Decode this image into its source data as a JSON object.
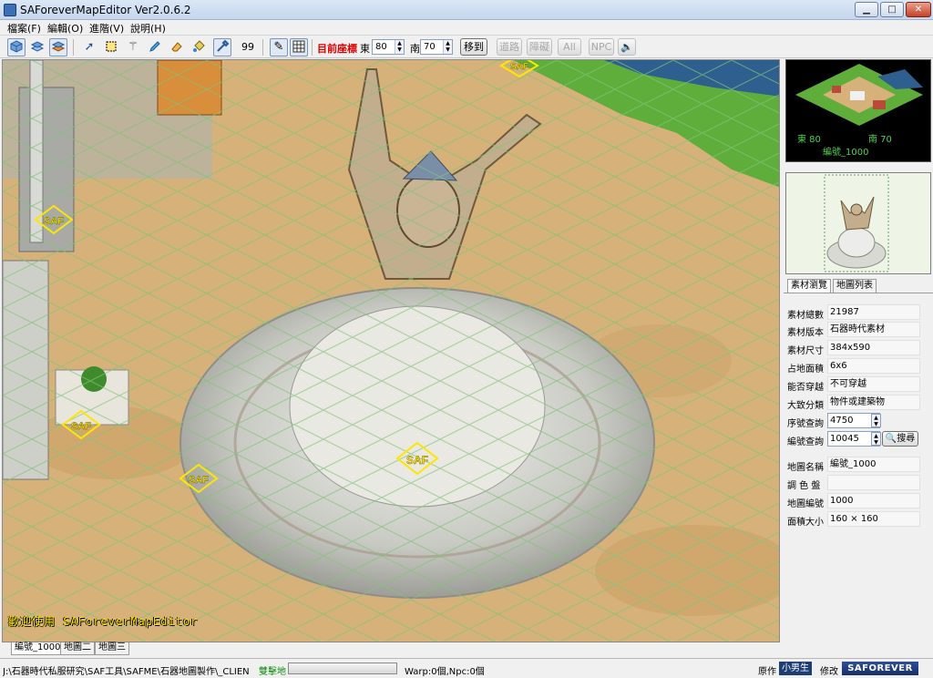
{
  "window": {
    "title": "SAForeverMapEditor Ver2.0.6.2",
    "min_icon": "minimize-icon",
    "max_icon": "maximize-icon",
    "close_icon": "close-icon"
  },
  "menu": [
    "檔案(F)",
    "編輯(O)",
    "進階(V)",
    "說明(H)"
  ],
  "toolbar": {
    "tools": [
      "layer-ground-icon",
      "layer-object-icon",
      "layer-combined-icon",
      "pointer-icon",
      "select-rect-icon",
      "magic-wand-icon",
      "pencil-icon",
      "eraser-icon",
      "fill-icon",
      "eyedropper-icon"
    ],
    "brush_size": "99",
    "coord_label": "目前座標",
    "east_label": "東",
    "east_value": "80",
    "south_label": "南",
    "south_value": "70",
    "goto_label": "移到",
    "road_label": "道路",
    "obstacle_label": "障礙",
    "all_label": "All",
    "npc_label": "NPC"
  },
  "map": {
    "welcome": "歡迎使用 SAForeverMapEditor",
    "marker_label": "SAF",
    "tabs": [
      "編號_1000",
      "地圖二",
      "地圖三"
    ],
    "active_tab": 0
  },
  "minimap": {
    "east": "東 80",
    "south": "南 70",
    "name": "編號_1000"
  },
  "panel": {
    "tabs": [
      "素材瀏覽",
      "地圖列表"
    ],
    "active_tab": 0,
    "props": {
      "total_label": "素材總數",
      "total": "21987",
      "version_label": "素材版本",
      "version": "石器時代素材",
      "size_label": "素材尺寸",
      "size": "384x590",
      "area_label": "占地面積",
      "area": "6x6",
      "pass_label": "能否穿越",
      "pass": "不可穿越",
      "category_label": "大致分類",
      "category": "物件或建築物",
      "serial_label": "序號查詢",
      "serial": "4750",
      "code_label": "編號查詢",
      "code": "10045",
      "search_label": "搜尋",
      "mapname_label": "地圖名稱",
      "mapname": "編號_1000",
      "palette_label": "調 色 盤",
      "palette": "",
      "mapcode_label": "地圖編號",
      "mapcode": "1000",
      "mapsize_label": "面積大小",
      "mapsize": "160 × 160"
    }
  },
  "status": {
    "path": "J:\\石器時代私服研究\\SAF工具\\SAFME\\石器地圖製作\\_CLIENT\\",
    "mode": "雙擊地",
    "progress": 0,
    "warp": "Warp:0個,Npc:0個",
    "original_label": "原作",
    "author": "小男生",
    "modify_label": "修改",
    "brand": "SAFOREVER"
  }
}
